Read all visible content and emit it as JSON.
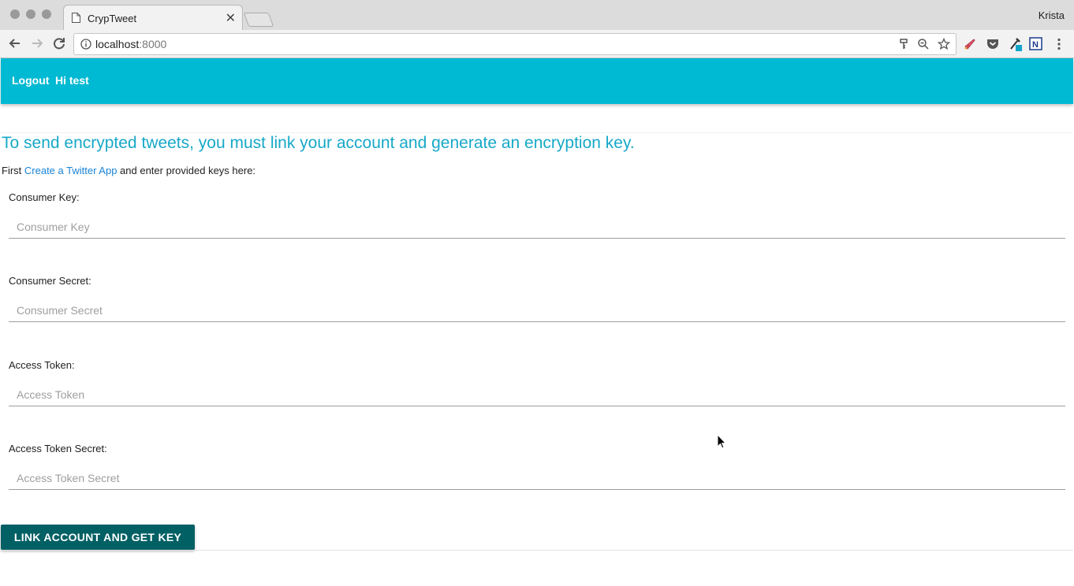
{
  "browser": {
    "tab_title": "CrypTweet",
    "profile_name": "Krista",
    "url_host": "localhost",
    "url_port": ":8000",
    "icons": [
      "back-icon",
      "forward-icon",
      "reload-icon",
      "info-icon",
      "key-icon",
      "zoom-out-icon",
      "star-icon",
      "rocket-icon",
      "pocket-icon",
      "eyedropper-icon",
      "n-extension-icon",
      "menu-icon"
    ]
  },
  "appbar": {
    "logout_label": "Logout",
    "greeting": "Hi test",
    "color": "#00b9d3"
  },
  "main": {
    "headline": "To send encrypted tweets, you must link your account and generate an encryption key.",
    "intro_prefix": "First ",
    "intro_link": "Create a Twitter App",
    "intro_suffix": " and enter provided keys here:",
    "fields": [
      {
        "label": "Consumer Key:",
        "placeholder": "Consumer Key",
        "value": ""
      },
      {
        "label": "Consumer Secret:",
        "placeholder": "Consumer Secret",
        "value": ""
      },
      {
        "label": "Access Token:",
        "placeholder": "Access Token",
        "value": ""
      },
      {
        "label": "Access Token Secret:",
        "placeholder": "Access Token Secret",
        "value": ""
      }
    ],
    "submit_label": "LINK ACCOUNT AND GET KEY",
    "submit_color": "#006064",
    "headline_color": "#17a8c8"
  }
}
